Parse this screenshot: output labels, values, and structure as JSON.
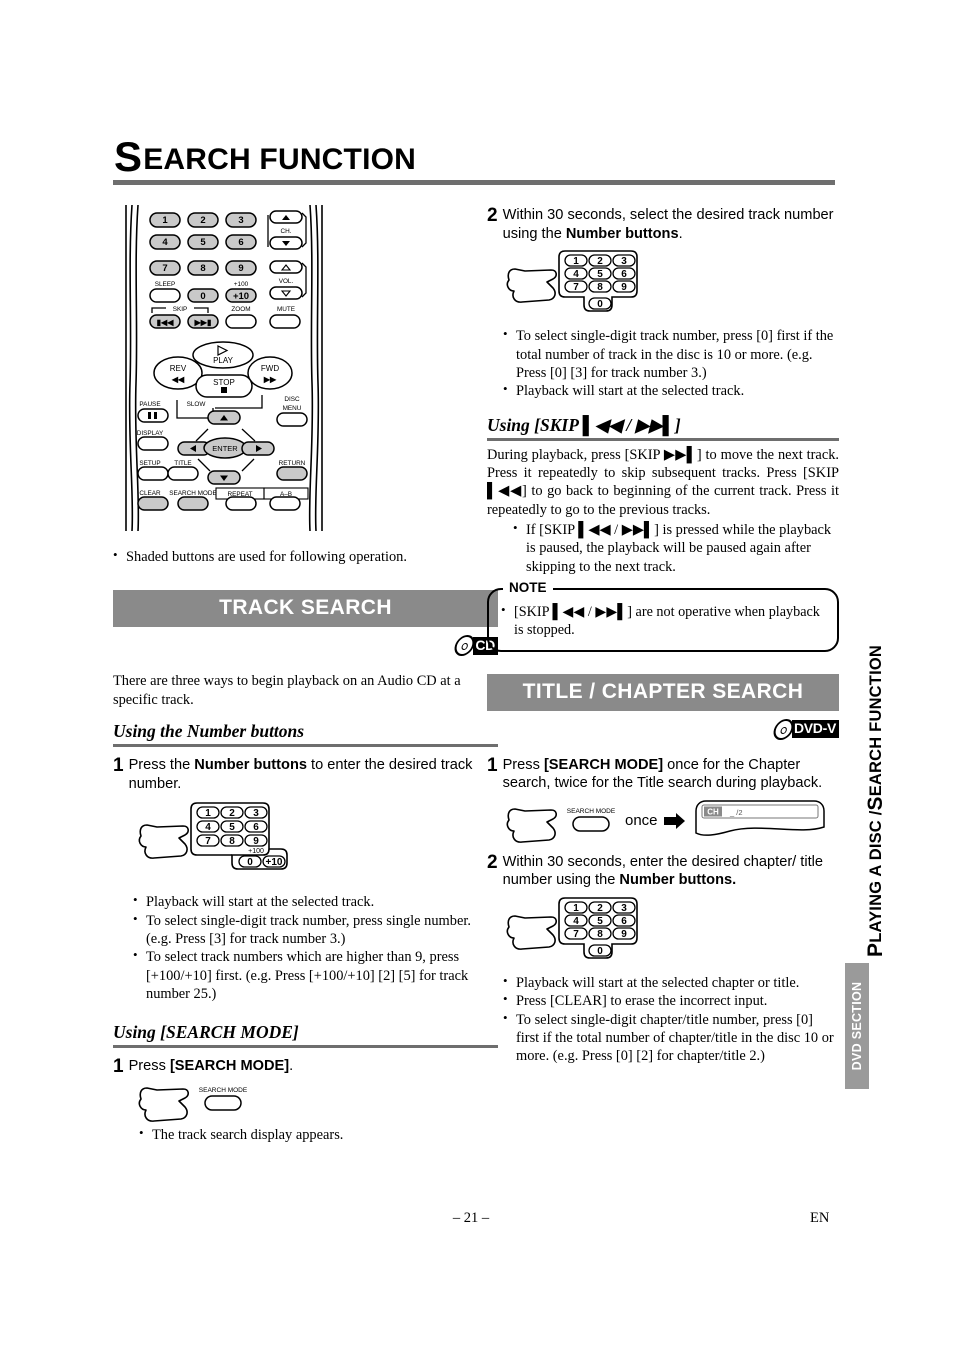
{
  "title": {
    "cap": "S",
    "rest": "EARCH FUNCTION"
  },
  "remote": {
    "buttons": [
      "1",
      "2",
      "3",
      "4",
      "5",
      "6",
      "7",
      "8",
      "9",
      "0",
      "+10"
    ],
    "labels": {
      "ch": "CH.",
      "vol": "VOL.",
      "sleep": "SLEEP",
      "plus100": "+100",
      "skip": "SKIP",
      "zoom": "ZOOM",
      "mute": "MUTE",
      "play": "PLAY",
      "stop": "STOP",
      "rev": "REV",
      "fwd": "FWD",
      "pause": "PAUSE",
      "slow": "SLOW",
      "disc_menu": "DISC\nMENU",
      "display": "DISPLAY",
      "enter": "ENTER",
      "setup": "SETUP",
      "title": "TITLE",
      "return": "RETURN",
      "clear": "CLEAR",
      "search_mode": "SEARCH MODE",
      "repeat": "REPEAT",
      "ab": "A–B"
    }
  },
  "left": {
    "shaded_note": "Shaded buttons are used for following operation.",
    "band_track_search": "TRACK SEARCH",
    "disc_logo_cd": "CD",
    "intro": "There are three ways to begin playback on an Audio CD at a specific track.",
    "subhead_number_buttons": "Using the Number buttons",
    "step1": {
      "num": "1",
      "text_pre": "Press the ",
      "text_bold": "Number buttons",
      "text_post": " to enter the desired track number."
    },
    "keypad_full": {
      "rows": [
        [
          "1",
          "2",
          "3"
        ],
        [
          "4",
          "5",
          "6"
        ],
        [
          "7",
          "8",
          "9"
        ]
      ],
      "bottom": [
        "0",
        "+10"
      ],
      "plus100_label": "+100"
    },
    "step1_bullets": [
      "Playback will start at the selected track.",
      "To select single-digit track number, press single number. (e.g. Press [3] for track number 3.)",
      "To select track numbers which are higher than 9, press [+100/+10] first. (e.g. Press [+100/+10] [2] [5] for track number 25.)"
    ],
    "subhead_search_mode": "Using [SEARCH MODE]",
    "step2": {
      "num": "1",
      "text_pre": "Press ",
      "text_bold": "[SEARCH MODE]",
      "text_post": "."
    },
    "search_mode_btn_label": "SEARCH MODE",
    "step2_bullets": [
      "The track search display appears."
    ]
  },
  "right": {
    "step_top": {
      "num": "2",
      "text_pre": "Within 30 seconds, select the desired track number using the ",
      "text_bold": "Number buttons",
      "text_post": "."
    },
    "keypad_simple": {
      "rows": [
        [
          "1",
          "2",
          "3"
        ],
        [
          "4",
          "5",
          "6"
        ],
        [
          "7",
          "8",
          "9"
        ]
      ],
      "bottom": [
        "0"
      ]
    },
    "step_top_bullets": [
      "To select single-digit track number, press [0] first if the total number of track in the disc is 10 or more. (e.g. Press [0] [3] for track number 3.)",
      "Playback will start at the selected track."
    ],
    "subhead_skip": "Using [SKIP ▌◀◀ / ▶▶▌]",
    "skip_para": "During playback, press [SKIP ▶▶▌] to move the next track. Press it repeatedly to skip subsequent tracks. Press [SKIP ▌◀◀] to go back to beginning of the current track. Press it repeatedly to go to the previous tracks.",
    "skip_bullet": "If [SKIP ▌◀◀ / ▶▶▌] is pressed while the playback is paused, the playback will be paused again after skipping to the next track.",
    "note_label": "NOTE",
    "note_bullet": "[SKIP ▌◀◀ / ▶▶▌] are not operative when playback is stopped.",
    "band_title_chapter": "TITLE / CHAPTER SEARCH",
    "disc_logo_dvd": "DVD-V",
    "step1": {
      "num": "1",
      "text_pre": "Press ",
      "text_bold": "[SEARCH MODE]",
      "text_post": " once for the Chapter search, twice for the Title search during playback."
    },
    "search_mode_btn_label": "SEARCH MODE",
    "once_label": "once",
    "display_panel": {
      "tag": "CH",
      "value": "_ /2"
    },
    "step2": {
      "num": "2",
      "text_pre": "Within 30 seconds, enter the desired chapter/ title number using the ",
      "text_bold": "Number buttons.",
      "text_post": ""
    },
    "step2_bullets": [
      "Playback will start at the selected chapter or title.",
      "Press [CLEAR] to erase the incorrect input.",
      "To select single-digit chapter/title number, press [0] first if the total number of chapter/title in the disc 10 or more. (e.g. Press [0] [2] for chapter/title 2.)"
    ]
  },
  "tabs": {
    "main_cap1": "P",
    "main_word1": "LAYING A DISC / ",
    "main_cap2": "S",
    "main_word2": "EARCH FUNCTION",
    "sub": "DVD SECTION"
  },
  "footer": {
    "page": "– 21 –",
    "lang": "EN"
  },
  "colors": {
    "band": "#8a8a8a",
    "rule": "#6e6e6e",
    "shade": "#c9c9c9"
  }
}
